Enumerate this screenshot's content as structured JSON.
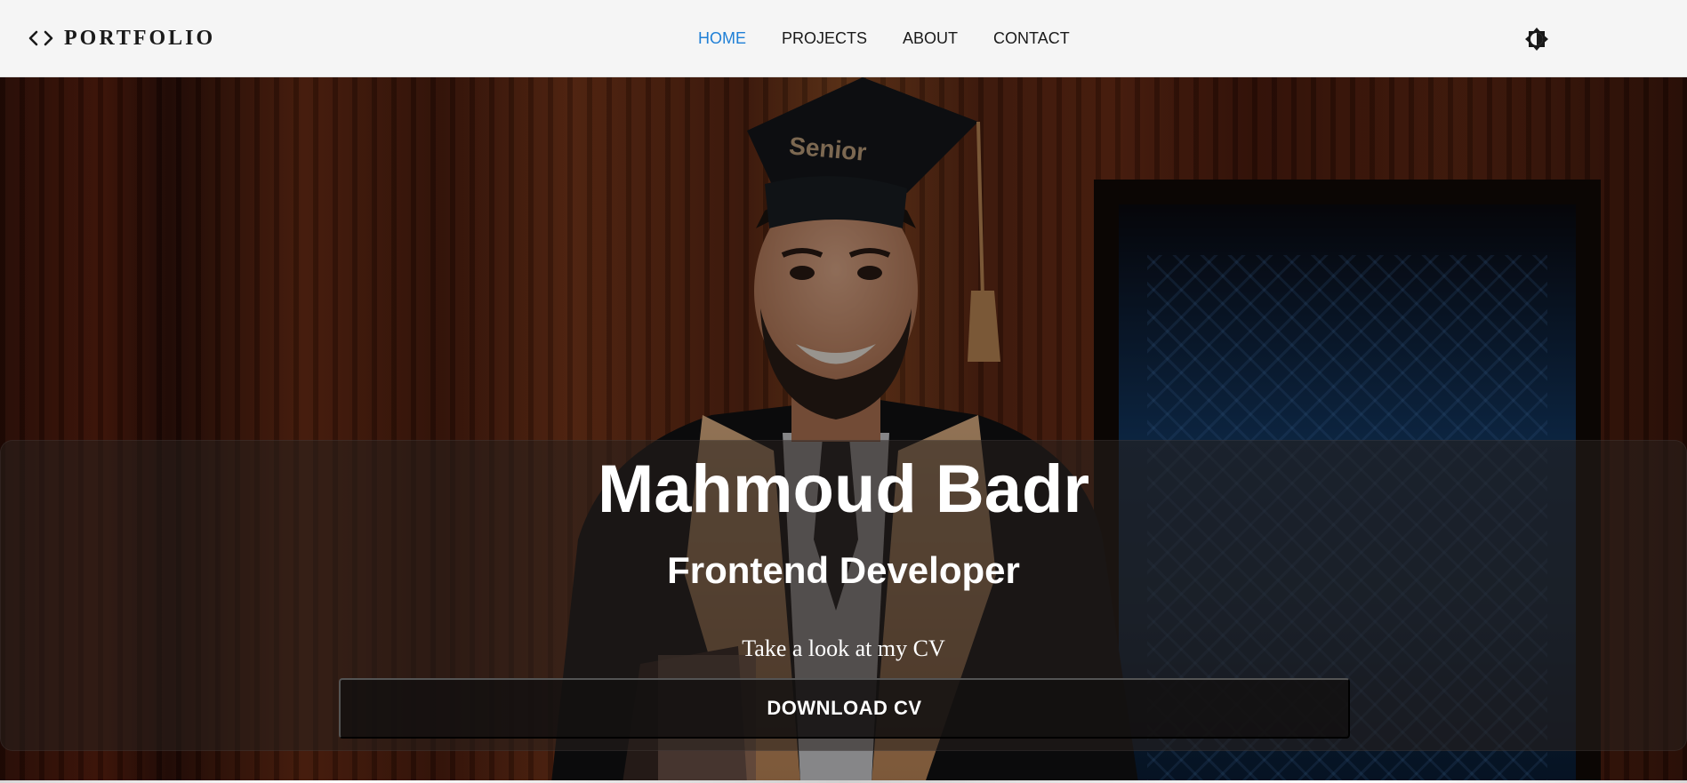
{
  "brand": {
    "logo_icon": "code-brackets-icon",
    "title": "PORTFOLIO"
  },
  "nav": {
    "items": [
      {
        "label": "HOME",
        "active": true
      },
      {
        "label": "PROJECTS",
        "active": false
      },
      {
        "label": "ABOUT",
        "active": false
      },
      {
        "label": "CONTACT",
        "active": false
      }
    ],
    "active_color": "#1e7fd6",
    "theme_toggle_icon": "brightness-icon"
  },
  "hero": {
    "name": "Mahmoud Badr",
    "role": "Frontend Developer",
    "cv_prompt": "Take a look at my CV",
    "download_label": "DOWNLOAD CV",
    "cap_text": "Senior"
  }
}
